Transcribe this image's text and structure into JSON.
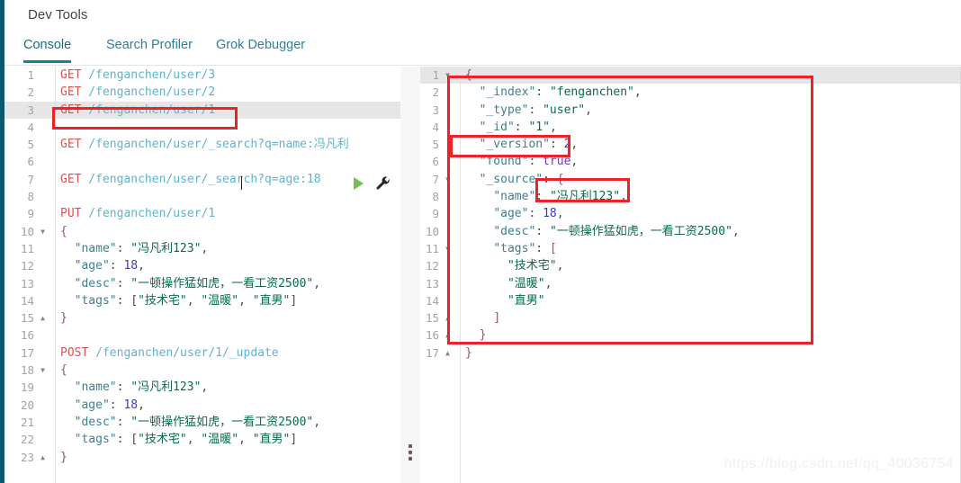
{
  "header": {
    "title": "Dev Tools"
  },
  "tabs": [
    {
      "id": "console",
      "label": "Console",
      "active": true
    },
    {
      "id": "search-profiler",
      "label": "Search Profiler",
      "active": false
    },
    {
      "id": "grok-debugger",
      "label": "Grok Debugger",
      "active": false
    }
  ],
  "toolbar": {
    "play_icon": "play-icon",
    "wrench_icon": "wrench-icon"
  },
  "request_editor": {
    "active_line": 3,
    "line_numbers": [
      "1",
      "2",
      "3",
      "4",
      "5",
      "6",
      "7",
      "8",
      "9",
      "10",
      "11",
      "12",
      "13",
      "14",
      "15",
      "16",
      "17",
      "18",
      "19",
      "20",
      "21",
      "22",
      "23"
    ],
    "folds": {
      "10": "open",
      "15": "close",
      "18": "open",
      "23": "close"
    },
    "lines": [
      {
        "n": 1,
        "tokens": [
          {
            "t": "GET",
            "c": "method"
          },
          {
            "t": " /fenganchen/user/3",
            "c": "url"
          }
        ]
      },
      {
        "n": 2,
        "tokens": [
          {
            "t": "GET",
            "c": "method"
          },
          {
            "t": " /fenganchen/user/2",
            "c": "url"
          }
        ]
      },
      {
        "n": 3,
        "tokens": [
          {
            "t": "GET",
            "c": "method"
          },
          {
            "t": " /fenganchen/user/1",
            "c": "url"
          }
        ]
      },
      {
        "n": 4,
        "tokens": []
      },
      {
        "n": 5,
        "tokens": [
          {
            "t": "GET",
            "c": "method"
          },
          {
            "t": " /fenganchen/user/_search?q=name:冯凡利",
            "c": "url"
          }
        ]
      },
      {
        "n": 6,
        "tokens": []
      },
      {
        "n": 7,
        "tokens": [
          {
            "t": "GET",
            "c": "method"
          },
          {
            "t": " /fenganchen/user/_search?q=age:18",
            "c": "url"
          }
        ]
      },
      {
        "n": 8,
        "tokens": []
      },
      {
        "n": 9,
        "tokens": [
          {
            "t": "PUT",
            "c": "method"
          },
          {
            "t": " /fenganchen/user/1",
            "c": "url"
          }
        ]
      },
      {
        "n": 10,
        "tokens": [
          {
            "t": "{",
            "c": "punct"
          }
        ]
      },
      {
        "n": 11,
        "tokens": [
          {
            "t": "  ",
            "c": "plain"
          },
          {
            "t": "\"name\"",
            "c": "key"
          },
          {
            "t": ": ",
            "c": "plain"
          },
          {
            "t": "\"冯凡利123\"",
            "c": "str"
          },
          {
            "t": ",",
            "c": "plain"
          }
        ]
      },
      {
        "n": 12,
        "tokens": [
          {
            "t": "  ",
            "c": "plain"
          },
          {
            "t": "\"age\"",
            "c": "key"
          },
          {
            "t": ": ",
            "c": "plain"
          },
          {
            "t": "18",
            "c": "num"
          },
          {
            "t": ",",
            "c": "plain"
          }
        ]
      },
      {
        "n": 13,
        "tokens": [
          {
            "t": "  ",
            "c": "plain"
          },
          {
            "t": "\"desc\"",
            "c": "key"
          },
          {
            "t": ": ",
            "c": "plain"
          },
          {
            "t": "\"一顿操作猛如虎，一看工资2500\"",
            "c": "str"
          },
          {
            "t": ",",
            "c": "plain"
          }
        ]
      },
      {
        "n": 14,
        "tokens": [
          {
            "t": "  ",
            "c": "plain"
          },
          {
            "t": "\"tags\"",
            "c": "key"
          },
          {
            "t": ": [",
            "c": "plain"
          },
          {
            "t": "\"技术宅\"",
            "c": "str"
          },
          {
            "t": ", ",
            "c": "plain"
          },
          {
            "t": "\"温暖\"",
            "c": "str"
          },
          {
            "t": ", ",
            "c": "plain"
          },
          {
            "t": "\"直男\"",
            "c": "str"
          },
          {
            "t": "]",
            "c": "plain"
          }
        ]
      },
      {
        "n": 15,
        "tokens": [
          {
            "t": "}",
            "c": "punct"
          }
        ]
      },
      {
        "n": 16,
        "tokens": []
      },
      {
        "n": 17,
        "tokens": [
          {
            "t": "POST",
            "c": "method"
          },
          {
            "t": " /fenganchen/user/1/_update",
            "c": "url"
          }
        ]
      },
      {
        "n": 18,
        "tokens": [
          {
            "t": "{",
            "c": "punct"
          }
        ]
      },
      {
        "n": 19,
        "tokens": [
          {
            "t": "  ",
            "c": "plain"
          },
          {
            "t": "\"name\"",
            "c": "key"
          },
          {
            "t": ": ",
            "c": "plain"
          },
          {
            "t": "\"冯凡利123\"",
            "c": "str"
          },
          {
            "t": ",",
            "c": "plain"
          }
        ]
      },
      {
        "n": 20,
        "tokens": [
          {
            "t": "  ",
            "c": "plain"
          },
          {
            "t": "\"age\"",
            "c": "key"
          },
          {
            "t": ": ",
            "c": "plain"
          },
          {
            "t": "18",
            "c": "num"
          },
          {
            "t": ",",
            "c": "plain"
          }
        ]
      },
      {
        "n": 21,
        "tokens": [
          {
            "t": "  ",
            "c": "plain"
          },
          {
            "t": "\"desc\"",
            "c": "key"
          },
          {
            "t": ": ",
            "c": "plain"
          },
          {
            "t": "\"一顿操作猛如虎，一看工资2500\"",
            "c": "str"
          },
          {
            "t": ",",
            "c": "plain"
          }
        ]
      },
      {
        "n": 22,
        "tokens": [
          {
            "t": "  ",
            "c": "plain"
          },
          {
            "t": "\"tags\"",
            "c": "key"
          },
          {
            "t": ": [",
            "c": "plain"
          },
          {
            "t": "\"技术宅\"",
            "c": "str"
          },
          {
            "t": ", ",
            "c": "plain"
          },
          {
            "t": "\"温暖\"",
            "c": "str"
          },
          {
            "t": ", ",
            "c": "plain"
          },
          {
            "t": "\"直男\"",
            "c": "str"
          },
          {
            "t": "]",
            "c": "plain"
          }
        ]
      },
      {
        "n": 23,
        "tokens": [
          {
            "t": "}",
            "c": "punct"
          }
        ]
      }
    ]
  },
  "response_editor": {
    "active_line": 1,
    "line_numbers": [
      "1",
      "2",
      "3",
      "4",
      "5",
      "6",
      "7",
      "8",
      "9",
      "10",
      "11",
      "12",
      "13",
      "14",
      "15",
      "16",
      "17"
    ],
    "folds": {
      "1": "open",
      "7": "open",
      "11": "open",
      "15": "close",
      "16": "close",
      "17": "close"
    },
    "lines": [
      {
        "n": 1,
        "tokens": [
          {
            "t": "{",
            "c": "punct"
          }
        ]
      },
      {
        "n": 2,
        "tokens": [
          {
            "t": "  ",
            "c": "plain"
          },
          {
            "t": "\"_index\"",
            "c": "key"
          },
          {
            "t": ": ",
            "c": "plain"
          },
          {
            "t": "\"fenganchen\"",
            "c": "str"
          },
          {
            "t": ",",
            "c": "plain"
          }
        ]
      },
      {
        "n": 3,
        "tokens": [
          {
            "t": "  ",
            "c": "plain"
          },
          {
            "t": "\"_type\"",
            "c": "key"
          },
          {
            "t": ": ",
            "c": "plain"
          },
          {
            "t": "\"user\"",
            "c": "str"
          },
          {
            "t": ",",
            "c": "plain"
          }
        ]
      },
      {
        "n": 4,
        "tokens": [
          {
            "t": "  ",
            "c": "plain"
          },
          {
            "t": "\"_id\"",
            "c": "key"
          },
          {
            "t": ": ",
            "c": "plain"
          },
          {
            "t": "\"1\"",
            "c": "str"
          },
          {
            "t": ",",
            "c": "plain"
          }
        ]
      },
      {
        "n": 5,
        "tokens": [
          {
            "t": "  ",
            "c": "plain"
          },
          {
            "t": "\"_version\"",
            "c": "key"
          },
          {
            "t": ": ",
            "c": "plain"
          },
          {
            "t": "2",
            "c": "num"
          },
          {
            "t": ",",
            "c": "plain"
          }
        ]
      },
      {
        "n": 6,
        "tokens": [
          {
            "t": "  ",
            "c": "plain"
          },
          {
            "t": "\"found\"",
            "c": "key"
          },
          {
            "t": ": ",
            "c": "plain"
          },
          {
            "t": "true",
            "c": "bool"
          },
          {
            "t": ",",
            "c": "plain"
          }
        ]
      },
      {
        "n": 7,
        "tokens": [
          {
            "t": "  ",
            "c": "plain"
          },
          {
            "t": "\"_source\"",
            "c": "key"
          },
          {
            "t": ": ",
            "c": "plain"
          },
          {
            "t": "{",
            "c": "punct"
          }
        ]
      },
      {
        "n": 8,
        "tokens": [
          {
            "t": "    ",
            "c": "plain"
          },
          {
            "t": "\"name\"",
            "c": "key"
          },
          {
            "t": ": ",
            "c": "plain"
          },
          {
            "t": "\"冯凡利123\"",
            "c": "str"
          },
          {
            "t": ",",
            "c": "plain"
          }
        ]
      },
      {
        "n": 9,
        "tokens": [
          {
            "t": "    ",
            "c": "plain"
          },
          {
            "t": "\"age\"",
            "c": "key"
          },
          {
            "t": ": ",
            "c": "plain"
          },
          {
            "t": "18",
            "c": "num"
          },
          {
            "t": ",",
            "c": "plain"
          }
        ]
      },
      {
        "n": 10,
        "tokens": [
          {
            "t": "    ",
            "c": "plain"
          },
          {
            "t": "\"desc\"",
            "c": "key"
          },
          {
            "t": ": ",
            "c": "plain"
          },
          {
            "t": "\"一顿操作猛如虎，一看工资2500\"",
            "c": "str"
          },
          {
            "t": ",",
            "c": "plain"
          }
        ]
      },
      {
        "n": 11,
        "tokens": [
          {
            "t": "    ",
            "c": "plain"
          },
          {
            "t": "\"tags\"",
            "c": "key"
          },
          {
            "t": ": ",
            "c": "plain"
          },
          {
            "t": "[",
            "c": "punct"
          }
        ]
      },
      {
        "n": 12,
        "tokens": [
          {
            "t": "      ",
            "c": "plain"
          },
          {
            "t": "\"技术宅\"",
            "c": "str"
          },
          {
            "t": ",",
            "c": "plain"
          }
        ]
      },
      {
        "n": 13,
        "tokens": [
          {
            "t": "      ",
            "c": "plain"
          },
          {
            "t": "\"温暖\"",
            "c": "str"
          },
          {
            "t": ",",
            "c": "plain"
          }
        ]
      },
      {
        "n": 14,
        "tokens": [
          {
            "t": "      ",
            "c": "plain"
          },
          {
            "t": "\"直男\"",
            "c": "str"
          }
        ]
      },
      {
        "n": 15,
        "tokens": [
          {
            "t": "    ",
            "c": "plain"
          },
          {
            "t": "]",
            "c": "punct"
          }
        ]
      },
      {
        "n": 16,
        "tokens": [
          {
            "t": "  ",
            "c": "plain"
          },
          {
            "t": "}",
            "c": "punct"
          }
        ]
      },
      {
        "n": 17,
        "tokens": [
          {
            "t": "}",
            "c": "punct"
          }
        ]
      }
    ]
  },
  "annotations": {
    "color": "#ec2227",
    "boxes": [
      {
        "id": "request-line",
        "target": "GET /fenganchen/user/1"
      },
      {
        "id": "version",
        "target": "\"_version\": 2,"
      },
      {
        "id": "name",
        "target": "\"冯凡利123\","
      },
      {
        "id": "response",
        "target": "response-json-block"
      }
    ]
  },
  "watermark": {
    "text": "https://blog.csdn.net/qq_40036754"
  },
  "colors": {
    "rail": "#0b5971",
    "tab_active": "#1b7e9c",
    "annotation_red": "#ec2227",
    "play_green": "#6ec04f",
    "method_red": "#d9534f",
    "url_blue": "#5eb3cf",
    "json_key": "#3c7f8f",
    "json_string": "#0a6b46",
    "json_number": "#3b3bc4",
    "json_bool": "#6a3ab8"
  }
}
